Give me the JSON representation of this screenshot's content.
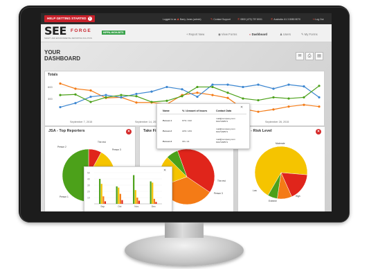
{
  "topbar": {
    "getting_started": "HELP GETTING STARTED",
    "help_glyph": "?",
    "logged_in": "Logged in as",
    "user": "Barry Jones (admin)",
    "support": "Contact Support",
    "phone1": "0800 (470) 757 8001",
    "phone2": "Australia: 61 3 8080 8070",
    "logout": "Log Out"
  },
  "header": {
    "logo_main": "SEE",
    "logo_forge": "FORGE",
    "logo_sub": "SAFETY AND ENVIRONMENTAL REPORTING SOLUTION",
    "badge": "HIPPA-HIGH-BITS",
    "nav": [
      {
        "label": "Report New",
        "icon": "+"
      },
      {
        "label": "View Forms",
        "icon": "◉"
      },
      {
        "label": "Dashboard",
        "icon": "◐"
      },
      {
        "label": "Users",
        "icon": "♟"
      },
      {
        "label": "My Forms",
        "icon": "✎"
      }
    ]
  },
  "dashboard": {
    "title_line1": "YOUR",
    "title_line2": "DASHBOARD",
    "totals": {
      "label": "Totals",
      "y_ticks": [
        "600",
        "300"
      ],
      "x_ticks": [
        "September 7, 2015",
        "September 14, 2015",
        "September 28, 2015"
      ]
    }
  },
  "cards": [
    {
      "title": "JSA - Top Reporters"
    },
    {
      "title": "Take Fi"
    },
    {
      "title": "ards - Risk Level"
    }
  ],
  "popup_table": {
    "headers": [
      "Name",
      "% / Amount of Issues",
      "Contact Data"
    ],
    "rows": [
      {
        "name": "Person 1",
        "issues": "67% / 102",
        "contact1": "mail@company.com",
        "contact2": "6017168571"
      },
      {
        "name": "Person 2",
        "issues": "22% / 234",
        "contact1": "mail@company.com",
        "contact2": "6017168571"
      },
      {
        "name": "Person 3",
        "issues": "3% / 21",
        "contact1": "mail@company.com",
        "contact2": "6017168571"
      }
    ]
  },
  "pie_labels": {
    "jsa": [
      "The rest",
      "Person 2",
      "Person 3",
      "Person 1"
    ],
    "take": [
      "The rest",
      "Person 3"
    ],
    "risk": [
      "Moderate",
      "Low",
      "Extreme",
      "High"
    ]
  },
  "colors": {
    "red": "#e0251b",
    "orange": "#f47b16",
    "yellow": "#f5c400",
    "green": "#4ca11a",
    "blue": "#3b86d1",
    "brand_red": "#c8202a"
  },
  "chart_data": [
    {
      "type": "line",
      "title": "Totals",
      "ylim": [
        100,
        750
      ],
      "x_tick_labels": [
        "September 7, 2015",
        "September 14, 2015",
        "September 28, 2015"
      ],
      "series": [
        {
          "color": "#f47b16",
          "values": [
            660,
            570,
            540,
            410,
            420,
            330,
            330,
            300,
            460,
            500,
            460,
            410,
            220,
            170,
            210,
            260,
            290,
            260
          ]
        },
        {
          "color": "#3b86d1",
          "values": [
            250,
            320,
            430,
            460,
            420,
            480,
            520,
            600,
            560,
            430,
            640,
            640,
            600,
            640,
            570,
            640,
            610,
            420
          ]
        },
        {
          "color": "#4ca11a",
          "values": [
            460,
            470,
            340,
            420,
            460,
            440,
            340,
            360,
            440,
            600,
            600,
            500,
            400,
            370,
            420,
            400,
            420,
            620
          ]
        }
      ]
    },
    {
      "type": "pie",
      "title": "JSA - Top Reporters",
      "slices": [
        {
          "label": "The rest",
          "value": 8,
          "color": "#e0251b"
        },
        {
          "label": "Person 2",
          "value": 27,
          "color": "#f5c400"
        },
        {
          "label": "Person 3",
          "value": 10,
          "color": "#f47b16"
        },
        {
          "label": "Person 1",
          "value": 55,
          "color": "#4ca11a"
        }
      ]
    },
    {
      "type": "pie",
      "title": "Take Fi",
      "slices": [
        {
          "label": "",
          "value": 40,
          "color": "#e0251b"
        },
        {
          "label": "",
          "value": 35,
          "color": "#f47b16"
        },
        {
          "label": "Person 3",
          "value": 18,
          "color": "#f5c400"
        },
        {
          "label": "The rest",
          "value": 7,
          "color": "#4ca11a"
        }
      ]
    },
    {
      "type": "pie",
      "title": "ards - Risk Level",
      "slices": [
        {
          "label": "Moderate",
          "value": 68,
          "color": "#f5c400"
        },
        {
          "label": "High",
          "value": 17,
          "color": "#e0251b"
        },
        {
          "label": "Extreme",
          "value": 9,
          "color": "#f47b16"
        },
        {
          "label": "Low",
          "value": 6,
          "color": "#4ca11a"
        }
      ]
    },
    {
      "type": "bar",
      "categories": [
        "Sep",
        "Oct",
        "Nov",
        "Dec"
      ],
      "ylim": [
        0,
        50
      ],
      "y_ticks": [
        "50",
        "40",
        "30",
        "20",
        "10"
      ],
      "series": [
        {
          "color": "#4ca11a",
          "values": [
            40,
            28,
            46,
            36
          ]
        },
        {
          "color": "#f5c400",
          "values": [
            32,
            26,
            22,
            34
          ]
        },
        {
          "color": "#f47b16",
          "values": [
            12,
            16,
            10,
            8
          ]
        },
        {
          "color": "#e0251b",
          "values": [
            4,
            6,
            5,
            3
          ]
        }
      ]
    }
  ]
}
